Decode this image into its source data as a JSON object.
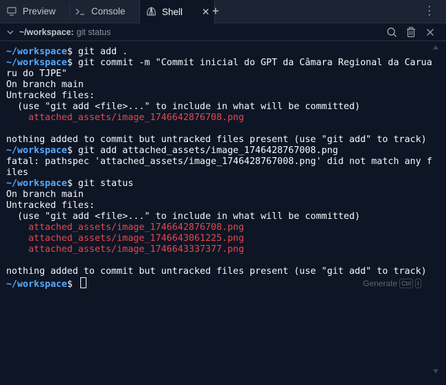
{
  "tabs": [
    {
      "label": "Preview",
      "icon": "monitor-icon"
    },
    {
      "label": "Console",
      "icon": "terminal-prompt-icon"
    },
    {
      "label": "Shell",
      "icon": "shell-icon"
    }
  ],
  "subheader": {
    "cwd": "~/workspace:",
    "command": "git status"
  },
  "prompt": "~/workspace",
  "lines": [
    {
      "prompt": true,
      "text": "$ git add ."
    },
    {
      "prompt": true,
      "text": "$ git commit -m \"Commit inicial do GPT da Câmara Regional da Carua"
    },
    {
      "text": "ru do TJPE\""
    },
    {
      "text": "On branch main"
    },
    {
      "text": "Untracked files:"
    },
    {
      "text": "  (use \"git add <file>...\" to include in what will be committed)"
    },
    {
      "text": "    attached_assets/image_1746642876708.png",
      "red": true
    },
    {
      "text": ""
    },
    {
      "text": "nothing added to commit but untracked files present (use \"git add\" to track)"
    },
    {
      "prompt": true,
      "text": "$ git add attached_assets/image_1746428767008.png"
    },
    {
      "text": "fatal: pathspec 'attached_assets/image_1746428767008.png' did not match any f"
    },
    {
      "text": "iles"
    },
    {
      "prompt": true,
      "text": "$ git status"
    },
    {
      "text": "On branch main"
    },
    {
      "text": "Untracked files:"
    },
    {
      "text": "  (use \"git add <file>...\" to include in what will be committed)"
    },
    {
      "text": "    attached_assets/image_1746642876708.png",
      "red": true
    },
    {
      "text": "    attached_assets/image_1746643061225.png",
      "red": true
    },
    {
      "text": "    attached_assets/image_1746643337377.png",
      "red": true
    },
    {
      "text": ""
    },
    {
      "text": "nothing added to commit but untracked files present (use \"git add\" to track)"
    },
    {
      "prompt": true,
      "text": "$ ",
      "cursor": true
    }
  ],
  "generate": {
    "label": "Generate",
    "key1": "Ctrl",
    "key2": "I"
  },
  "colors": {
    "prompt": "#57abff",
    "error": "#e5484d",
    "background": "#0e1525"
  }
}
